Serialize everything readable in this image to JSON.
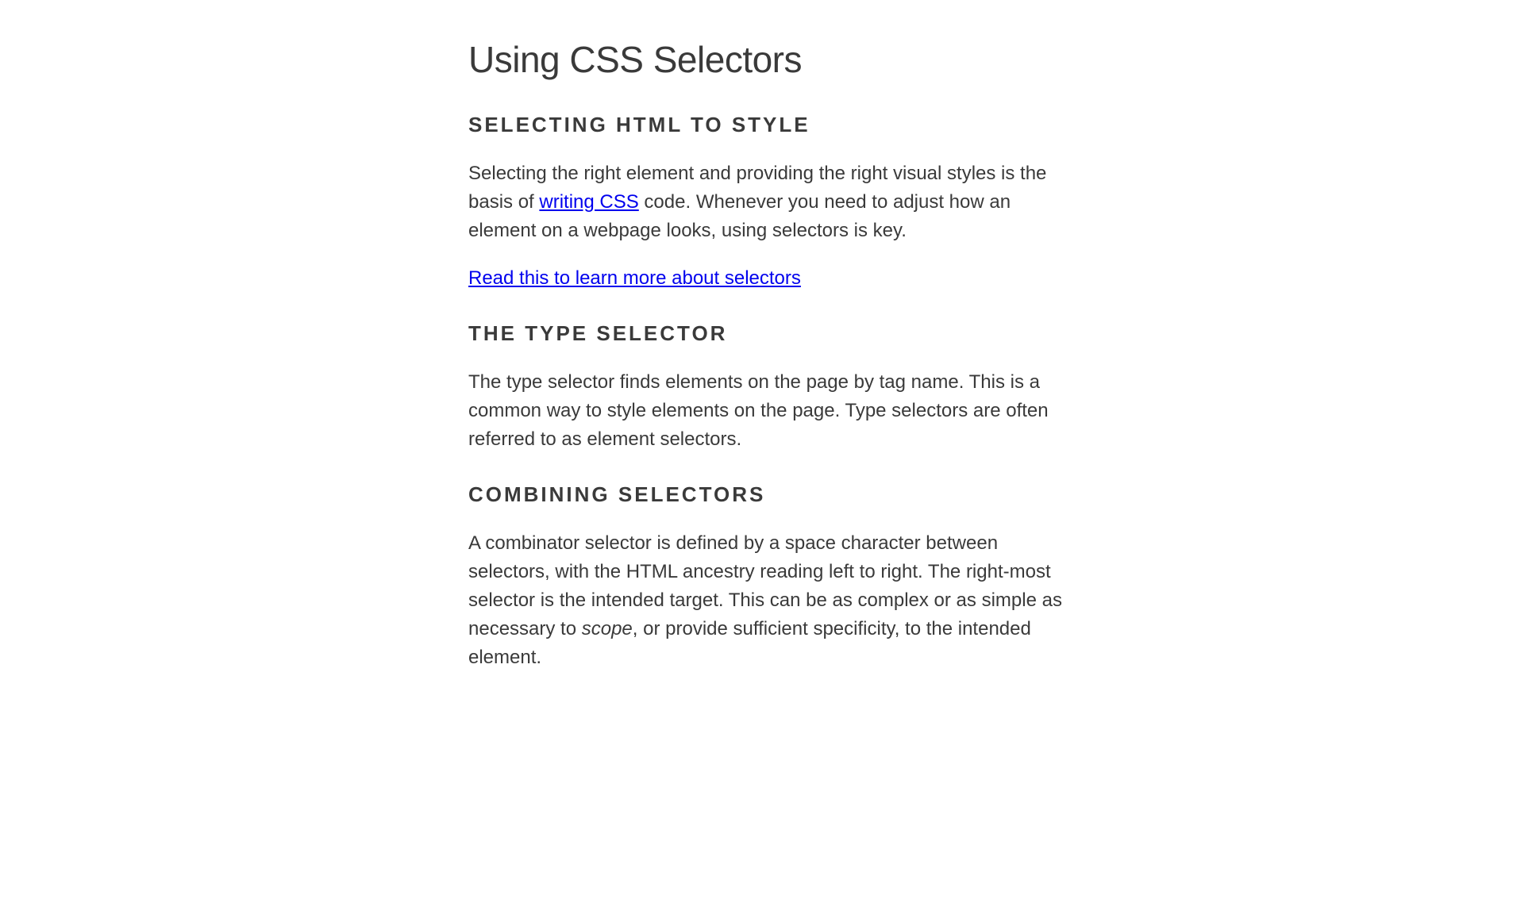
{
  "title": "Using CSS Selectors",
  "sections": [
    {
      "heading": "SELECTING HTML TO STYLE",
      "para1_before": "Selecting the right element and providing the right visual styles is the basis of ",
      "para1_link": "writing CSS",
      "para1_after": " code. Whenever you need to adjust how an element on a webpage looks, using selectors is key.",
      "link2": "Read this to learn more about selectors"
    },
    {
      "heading": "THE TYPE SELECTOR",
      "para": "The type selector finds elements on the page by tag name. This is a common way to style elements on the page. Type selectors are often referred to as element selectors."
    },
    {
      "heading": "COMBINING SELECTORS",
      "para_before": "A combinator selector is defined by a space character between selectors, with the HTML ancestry reading left to right. The right-most selector is the intended target. This can be as complex or as simple as necessary to ",
      "para_em": "scope",
      "para_after": ", or provide sufficient specificity, to the intended element."
    }
  ]
}
